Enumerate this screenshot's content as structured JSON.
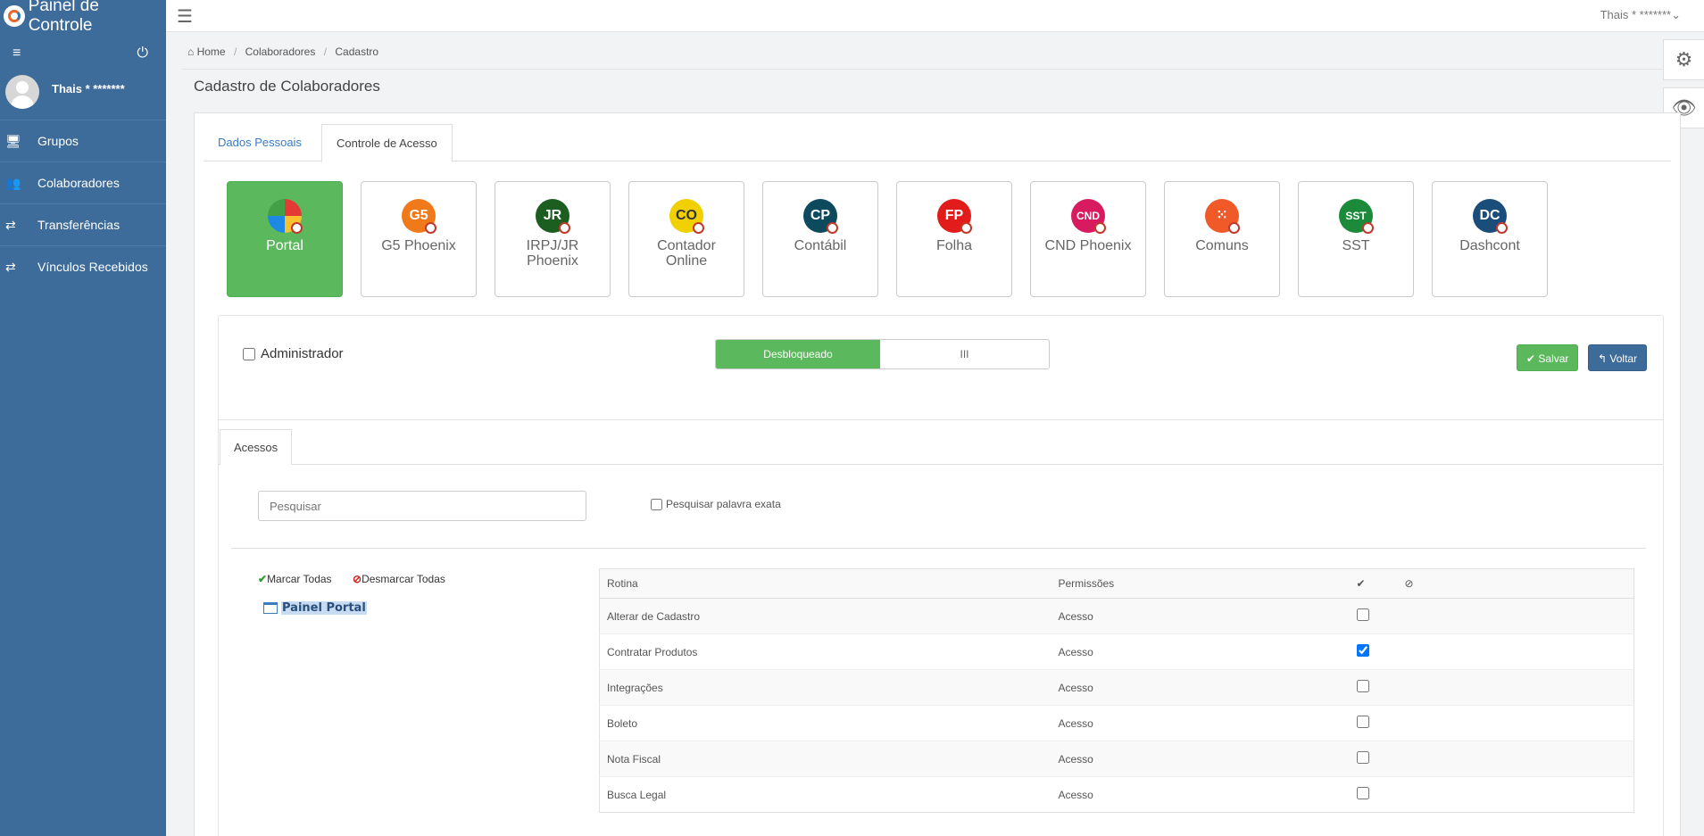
{
  "sidebar": {
    "brand_title": "Painel de Controle",
    "user_name": "Thais * *******",
    "menu_icon": "≡",
    "power_icon": "⏻",
    "items": [
      {
        "label": "Grupos",
        "icon": "monitor-icon"
      },
      {
        "label": "Colaboradores",
        "icon": "users-icon"
      },
      {
        "label": "Transferências",
        "icon": "transfer-icon"
      },
      {
        "label": "Vínculos Recebidos",
        "icon": "transfer-icon"
      }
    ]
  },
  "topbar": {
    "hamburger": "☰",
    "user": "Thais * *******⌄"
  },
  "breadcrumb": {
    "home": "Home",
    "level1": "Colaboradores",
    "level2": "Cadastro"
  },
  "page_title": "Cadastro de Colaboradores",
  "tabs": {
    "dados": "Dados Pessoais",
    "controle": "Controle de Acesso"
  },
  "apps": [
    {
      "label": "Portal",
      "abbr": "",
      "color": "#5cb85c",
      "active": true
    },
    {
      "label": "G5 Phoenix",
      "abbr": "G5",
      "color": "#f07a1a"
    },
    {
      "label": "IRPJ/JR Phoenix",
      "abbr": "JR",
      "color": "#1b5e20"
    },
    {
      "label": "Contador Online",
      "abbr": "CO",
      "color": "#f0d000"
    },
    {
      "label": "Contábil",
      "abbr": "CP",
      "color": "#0d4a5e"
    },
    {
      "label": "Folha",
      "abbr": "FP",
      "color": "#e21b1b"
    },
    {
      "label": "CND Phoenix",
      "abbr": "CND",
      "color": "#d81b60"
    },
    {
      "label": "Comuns",
      "abbr": "⁙",
      "color": "#f05a28"
    },
    {
      "label": "SST",
      "abbr": "SST",
      "color": "#1b8a3a"
    },
    {
      "label": "Dashcont",
      "abbr": "DC",
      "color": "#1a4d7a"
    }
  ],
  "controls": {
    "admin_label": "Administrador",
    "toggle_on": "Desbloqueado",
    "toggle_off": "III",
    "save": "✔ Salvar",
    "back": "↰ Voltar"
  },
  "access": {
    "tab": "Acessos",
    "search_placeholder": "Pesquisar",
    "exact_label": "Pesquisar palavra exata",
    "mark_all": "Marcar Todas",
    "unmark_all": "Desmarcar Todas",
    "tree_root": "Painel Portal"
  },
  "table": {
    "headers": {
      "rotina": "Rotina",
      "permissoes": "Permissões",
      "check": "✔",
      "ban": "⊘"
    },
    "rows": [
      {
        "rotina": "Alterar de Cadastro",
        "perm": "Acesso",
        "checked": false
      },
      {
        "rotina": "Contratar Produtos",
        "perm": "Acesso",
        "checked": true
      },
      {
        "rotina": "Integrações",
        "perm": "Acesso",
        "checked": false
      },
      {
        "rotina": "Boleto",
        "perm": "Acesso",
        "checked": false
      },
      {
        "rotina": "Nota Fiscal",
        "perm": "Acesso",
        "checked": false
      },
      {
        "rotina": "Busca Legal",
        "perm": "Acesso",
        "checked": false
      }
    ]
  }
}
